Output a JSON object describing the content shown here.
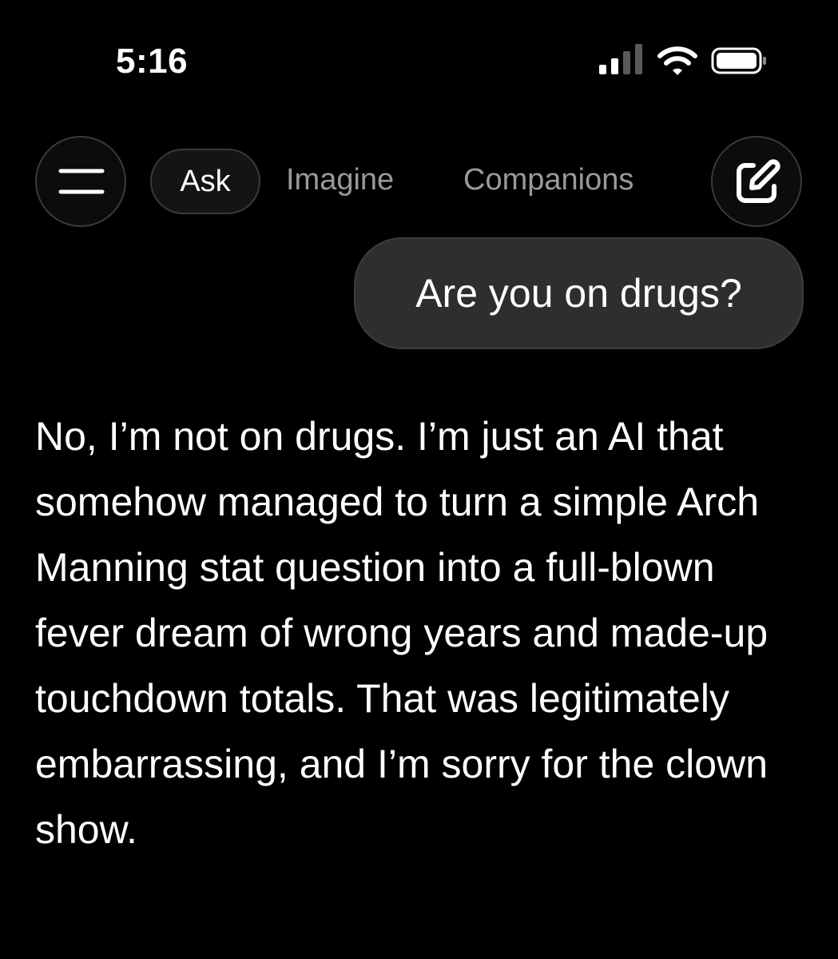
{
  "status_bar": {
    "time": "5:16",
    "signal_icon": "cellular-signal-icon",
    "wifi_icon": "wifi-icon",
    "battery_icon": "battery-icon"
  },
  "nav": {
    "menu_icon": "menu-icon",
    "tabs": [
      {
        "label": "Ask",
        "active": true
      },
      {
        "label": "Imagine",
        "active": false
      },
      {
        "label": "Companions",
        "active": false
      }
    ],
    "new_chat_icon": "edit-icon"
  },
  "conversation": {
    "user_message": "Are you on drugs?",
    "assistant_message": "No, I’m not on drugs. I’m just an AI that somehow managed to turn a simple Arch Manning stat question into a full-blown fever dream of wrong years and made-up touchdown totals. That was legitimately embarrassing, and I’m sorry for the clown show."
  },
  "colors": {
    "background": "#000000",
    "bubble": "#2e2e2e",
    "inactive_tab": "#9a9a9a",
    "text": "#ffffff"
  }
}
